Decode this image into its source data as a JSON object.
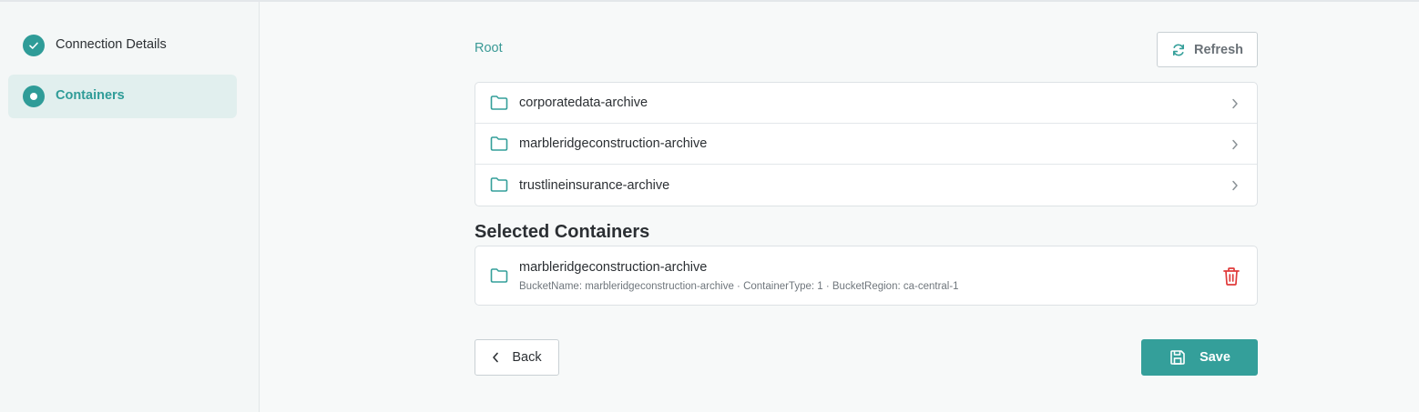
{
  "sidebar": {
    "steps": [
      {
        "label": "Connection Details",
        "state": "completed"
      },
      {
        "label": "Containers",
        "state": "active"
      }
    ]
  },
  "breadcrumb": {
    "root": "Root"
  },
  "toolbar": {
    "refresh_label": "Refresh"
  },
  "containers": [
    {
      "name": "corporatedata-archive"
    },
    {
      "name": "marbleridgeconstruction-archive"
    },
    {
      "name": "trustlineinsurance-archive"
    }
  ],
  "selected": {
    "title": "Selected Containers",
    "items": [
      {
        "name": "marbleridgeconstruction-archive",
        "meta": "BucketName: marbleridgeconstruction-archive · ContainerType: 1 · BucketRegion: ca-central-1"
      }
    ]
  },
  "footer": {
    "back_label": "Back",
    "save_label": "Save"
  },
  "colors": {
    "accent": "#349f9a",
    "danger": "#e03a3a"
  },
  "icons": {
    "step_completed": "check-icon",
    "step_active": "dot-icon",
    "refresh": "refresh-icon",
    "folder": "folder-icon",
    "chevron": "chevron-right-icon",
    "delete": "trash-icon",
    "back": "chevron-left-icon",
    "save": "floppy-disk-icon"
  }
}
